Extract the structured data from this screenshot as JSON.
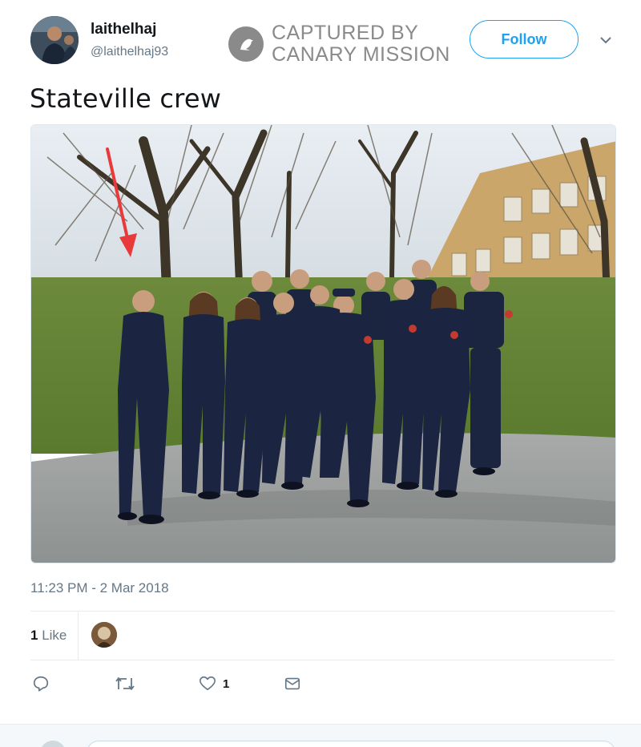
{
  "user": {
    "display_name": "laithelhaj",
    "handle": "@laithelhaj93"
  },
  "watermark": {
    "line1": "CAPTURED BY",
    "line2": "CANARY MISSION"
  },
  "follow_label": "Follow",
  "tweet": {
    "text": "Stateville crew",
    "timestamp": "11:23 PM - 2 Mar 2018"
  },
  "stats": {
    "likes_count": "1",
    "likes_label": "Like"
  },
  "actions": {
    "like_count": "1"
  },
  "icons": {
    "reply": "reply-icon",
    "retweet": "retweet-icon",
    "like": "heart-icon",
    "message": "envelope-icon",
    "menu": "chevron-down-icon"
  },
  "colors": {
    "accent": "#1da1f2",
    "muted_text": "#657786",
    "watermark": "#8a8a8a",
    "arrow": "#e83a3a"
  }
}
